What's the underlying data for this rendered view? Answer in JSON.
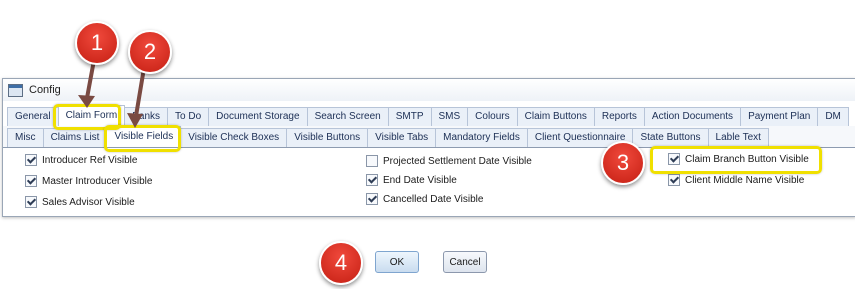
{
  "window": {
    "title": "Config"
  },
  "tabs_row1": [
    "General",
    "Claim Form",
    "Banks",
    "To Do",
    "Document Storage",
    "Search Screen",
    "SMTP",
    "SMS",
    "Colours",
    "Claim Buttons",
    "Reports",
    "Action Documents",
    "Payment Plan",
    "DM"
  ],
  "tabs_row2": [
    "Misc",
    "Claims List",
    "Visible Fields",
    "Visible Check Boxes",
    "Visible Buttons",
    "Visible Tabs",
    "Mandatory Fields",
    "Client Questionnaire",
    "State Buttons",
    "Lable Text"
  ],
  "fields": {
    "col1": [
      {
        "label": "Introducer Ref Visible",
        "checked": true
      },
      {
        "label": "Master Introducer Visible",
        "checked": true
      },
      {
        "label": "Sales Advisor Visible",
        "checked": true
      }
    ],
    "col2": [
      {
        "label": "Projected Settlement Date Visible",
        "checked": false
      },
      {
        "label": "End Date Visible",
        "checked": true
      },
      {
        "label": "Cancelled Date Visible",
        "checked": true
      }
    ],
    "col3": [
      {
        "label": "Claim Branch Button Visible",
        "checked": true
      },
      {
        "label": "Client Middle Name Visible",
        "checked": true
      }
    ]
  },
  "buttons": {
    "ok": "OK",
    "cancel": "Cancel"
  },
  "callouts": [
    "1",
    "2",
    "3",
    "4"
  ],
  "colors": {
    "callout": "#d9261c",
    "highlight": "#f0e000",
    "arrow": "#7a4a42"
  }
}
